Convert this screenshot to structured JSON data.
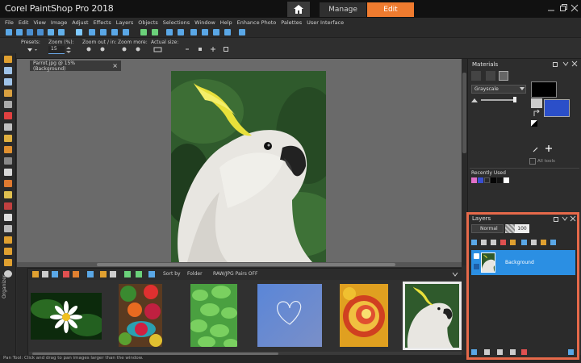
{
  "app": {
    "title": "Corel PaintShop Pro 2018",
    "tabs": [
      {
        "label": "Manage",
        "active": false
      },
      {
        "label": "Edit",
        "active": true
      }
    ],
    "accent_color": "#ef7b2f"
  },
  "menu": [
    "File",
    "Edit",
    "View",
    "Image",
    "Adjust",
    "Effects",
    "Layers",
    "Objects",
    "Selections",
    "Window",
    "Help",
    "Enhance Photo",
    "Palettes",
    "User Interface"
  ],
  "options": {
    "presets_label": "Presets:",
    "zoom_label": "Zoom (%):",
    "zoom_value": "15",
    "zoom_out_label": "Zoom out / in:",
    "zoom_more_label": "Zoom more:",
    "actual_size_label": "Actual size:"
  },
  "document": {
    "tab_label": "Parrot.jpg @ 15% (Background)",
    "close_glyph": "×"
  },
  "organizer": {
    "label": "Organizer",
    "sort_label": "Sort by",
    "folder_label": "Folder",
    "pairs_label": "RAW/JPG Pairs OFF",
    "thumbnails": [
      "daisy",
      "vegetables",
      "leaves",
      "heart",
      "spiral",
      "parrot"
    ]
  },
  "materials": {
    "title": "Materials",
    "mode": "Grayscale",
    "all_tools": "All tools",
    "recently_used": "Recently Used",
    "foreground": "#000000",
    "background": "#2b4fc9",
    "recent_colors": [
      "#e070c8",
      "#3a4fd0",
      "#2a2a2a",
      "#050505",
      "#111111",
      "#ffffff"
    ]
  },
  "layers": {
    "title": "Layers",
    "blend_mode": "Normal",
    "opacity": "100",
    "items": [
      {
        "name": "Background",
        "selected": true
      }
    ]
  },
  "status": {
    "text": "Pan Tool: Click and drag to pan images larger than the window."
  }
}
